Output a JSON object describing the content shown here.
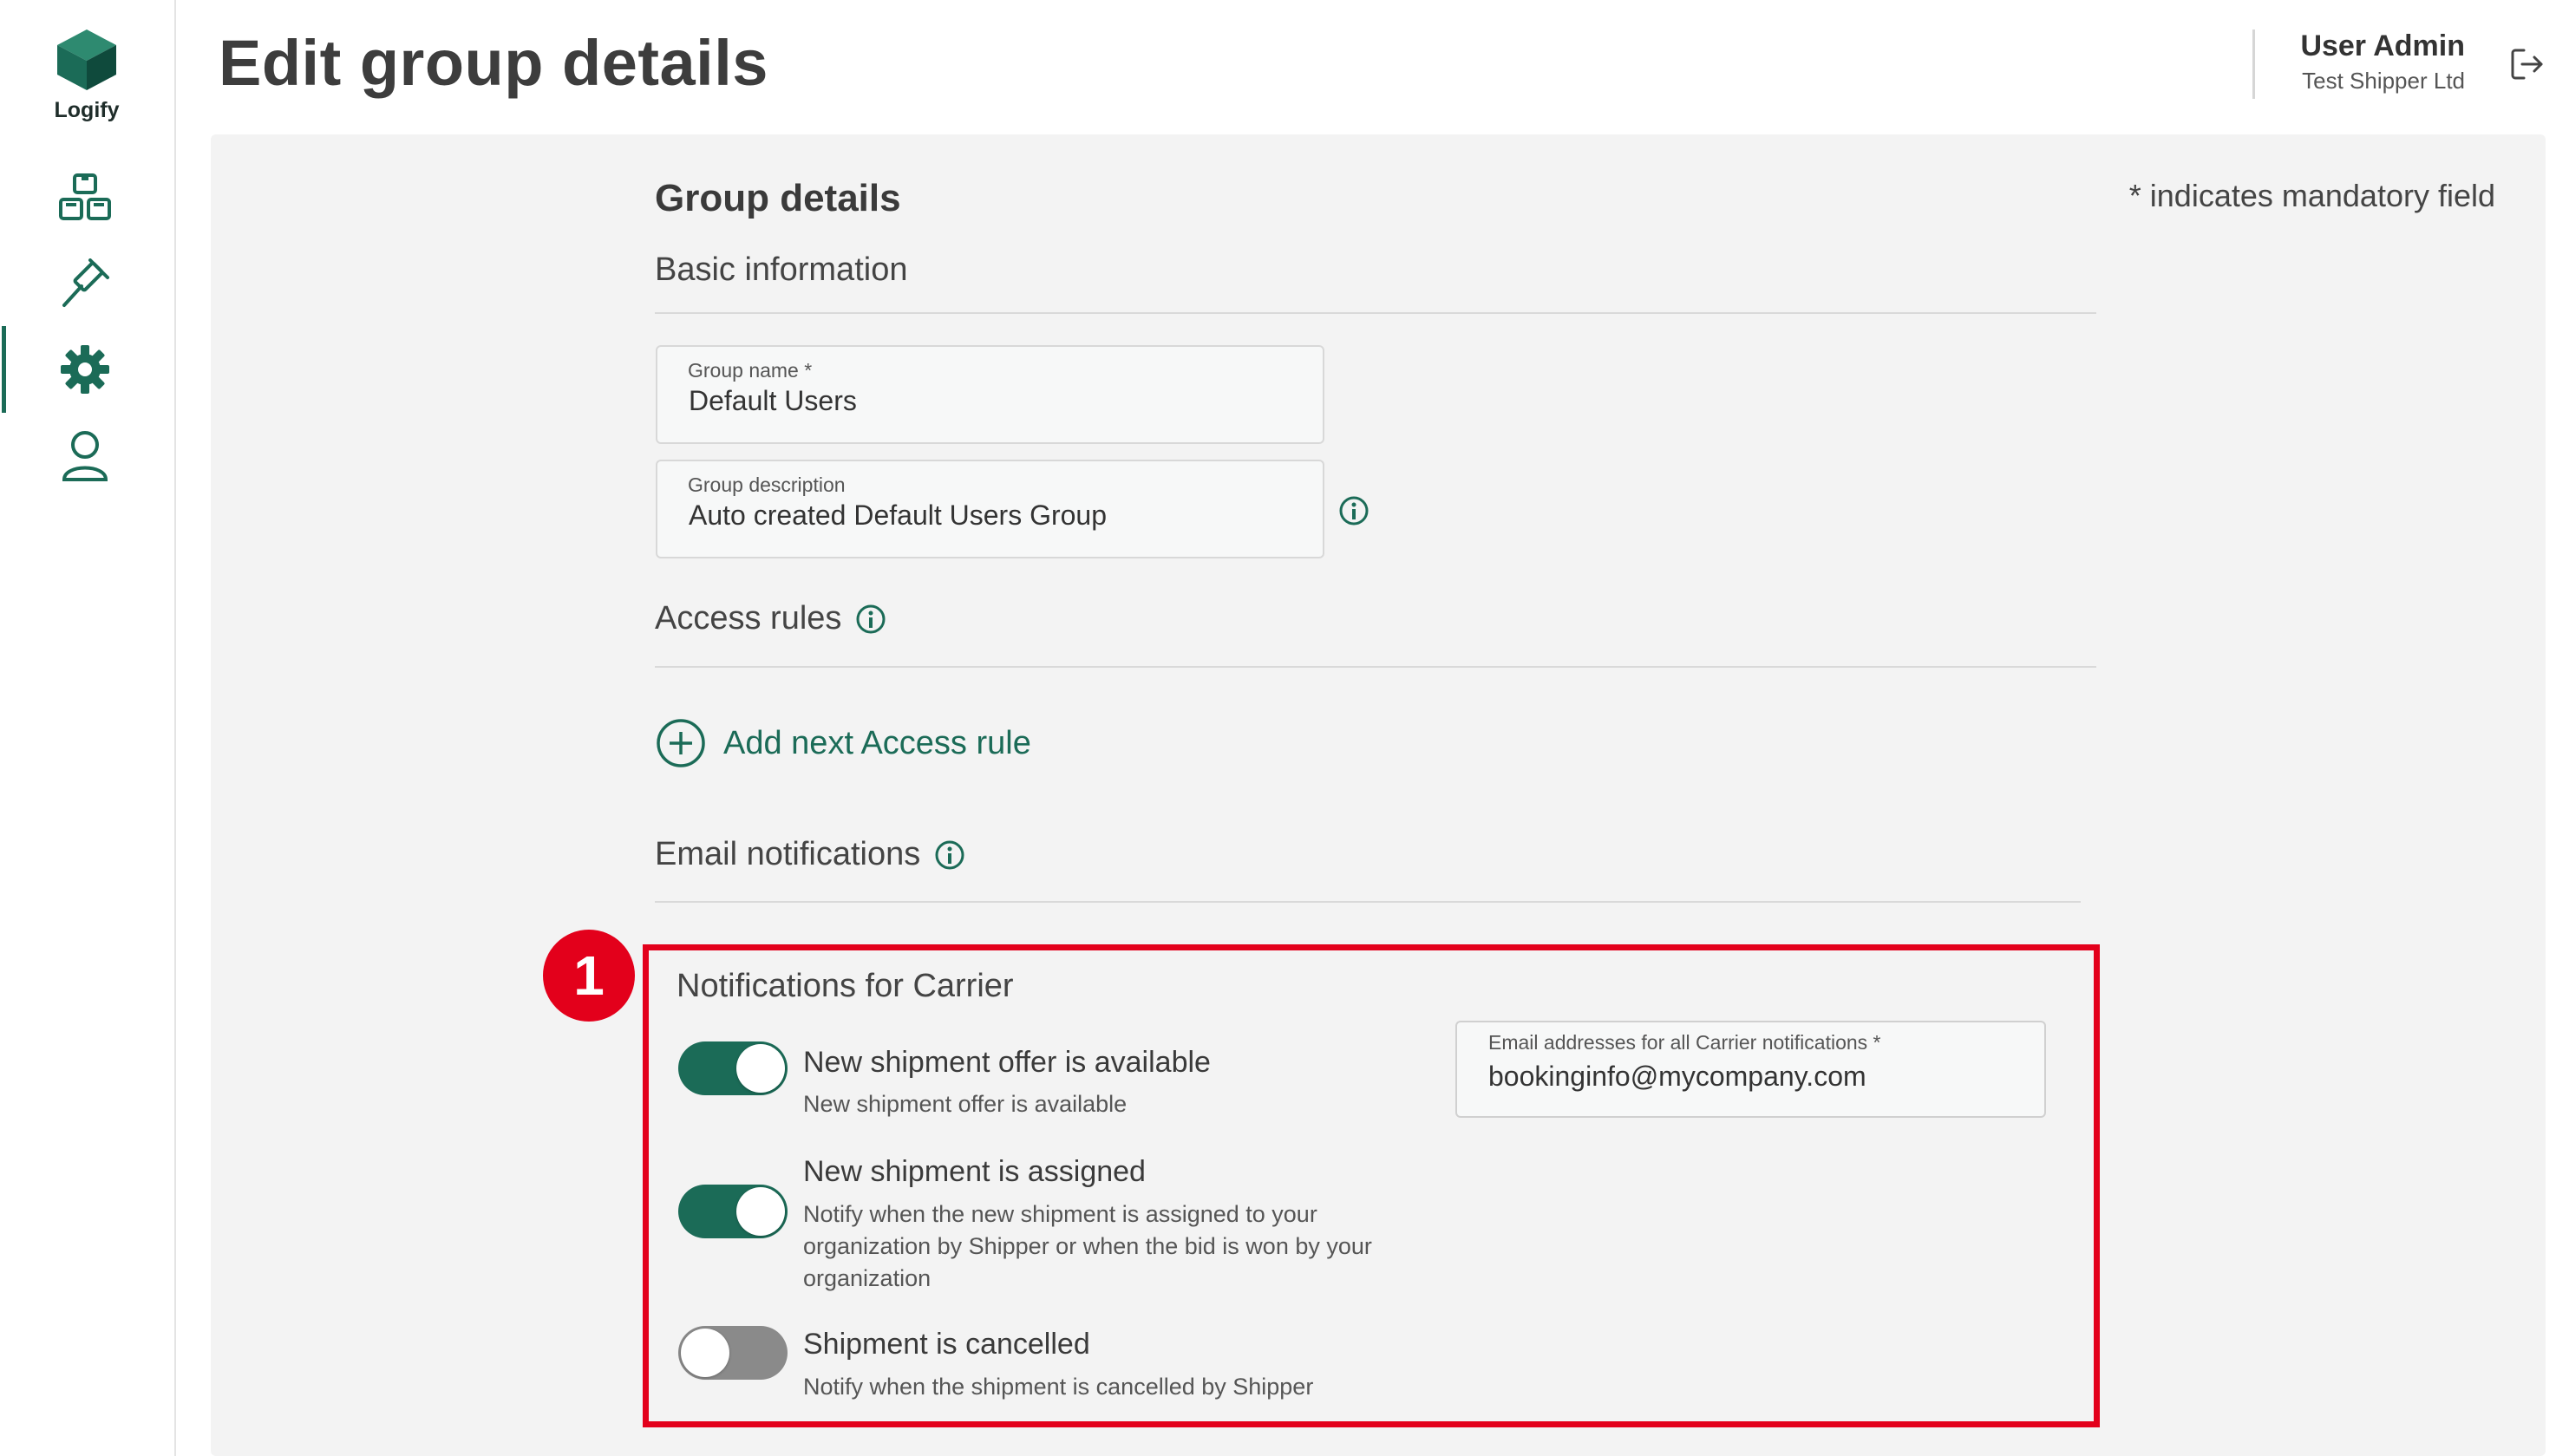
{
  "app": {
    "name": "Logify",
    "accent_color": "#1b6b57",
    "highlight_color": "#e3001b"
  },
  "sidebar": {
    "items": [
      {
        "name": "shipments",
        "icon": "boxes-icon",
        "active": false
      },
      {
        "name": "auctions",
        "icon": "gavel-icon",
        "active": false
      },
      {
        "name": "settings",
        "icon": "gear-icon",
        "active": true
      },
      {
        "name": "profile",
        "icon": "user-icon",
        "active": false
      }
    ]
  },
  "header": {
    "title": "Edit group details",
    "user_name": "User Admin",
    "user_org": "Test Shipper Ltd"
  },
  "form": {
    "section_title": "Group details",
    "mandatory_note": "* indicates mandatory field",
    "basic_info_label": "Basic information",
    "group_name": {
      "label": "Group name *",
      "value": "Default Users"
    },
    "group_description": {
      "label": "Group description",
      "value": "Auto created Default Users Group"
    },
    "access_rules_label": "Access rules",
    "add_access_rule_label": "Add next Access rule",
    "email_notifications_label": "Email notifications"
  },
  "carrier_notifications": {
    "callout_number": "1",
    "title": "Notifications for Carrier",
    "email_field": {
      "label": "Email addresses for all Carrier notifications *",
      "value": "bookinginfo@mycompany.com"
    },
    "options": [
      {
        "title": "New shipment offer is available",
        "description": "New shipment offer is available",
        "enabled": true
      },
      {
        "title": "New shipment is assigned",
        "description": "Notify when the new shipment is assigned to your organization by Shipper or when the bid is won by your organization",
        "enabled": true
      },
      {
        "title": "Shipment is cancelled",
        "description": "Notify when the shipment is cancelled by Shipper",
        "enabled": false
      }
    ]
  }
}
